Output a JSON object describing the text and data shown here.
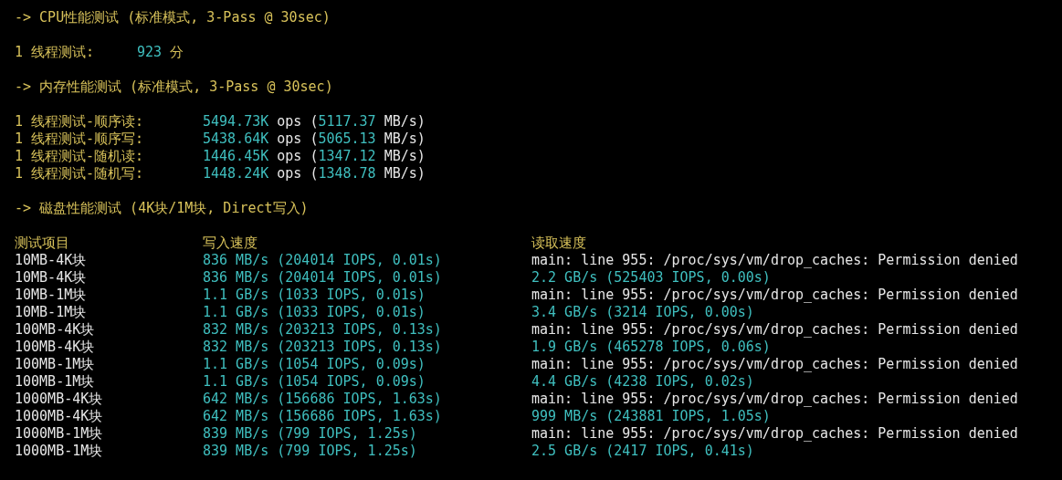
{
  "terminal": {
    "lines": [
      {
        "kind": "text",
        "cells": [
          [
            {
              "text": "-> CPU性能测试 (标准模式, 3-Pass @ 30sec)",
              "color": "#d8c25a"
            }
          ]
        ]
      },
      {
        "kind": "blank"
      },
      {
        "kind": "score",
        "cells": [
          [
            {
              "text": "1 线程测试:",
              "color": "#d8c25a"
            }
          ],
          [
            {
              "text": "923",
              "color": "#3fbfbf"
            },
            {
              "text": " 分",
              "color": "#d8c25a"
            }
          ]
        ]
      },
      {
        "kind": "blank"
      },
      {
        "kind": "text",
        "cells": [
          [
            {
              "text": "-> 内存性能测试 (标准模式, 3-Pass @ 30sec)",
              "color": "#d8c25a"
            }
          ]
        ]
      },
      {
        "kind": "blank"
      },
      {
        "kind": "metric",
        "cells": [
          [
            {
              "text": "1 线程测试-顺序读:",
              "color": "#d8c25a"
            }
          ],
          [
            {
              "text": "5494.73K",
              "color": "#3fbfbf"
            },
            {
              "text": " ops (",
              "color": "#e6e6e6"
            },
            {
              "text": "5117.37",
              "color": "#3fbfbf"
            },
            {
              "text": " MB/s)",
              "color": "#e6e6e6"
            }
          ]
        ]
      },
      {
        "kind": "metric",
        "cells": [
          [
            {
              "text": "1 线程测试-顺序写:",
              "color": "#d8c25a"
            }
          ],
          [
            {
              "text": "5438.64K",
              "color": "#3fbfbf"
            },
            {
              "text": " ops (",
              "color": "#e6e6e6"
            },
            {
              "text": "5065.13",
              "color": "#3fbfbf"
            },
            {
              "text": " MB/s)",
              "color": "#e6e6e6"
            }
          ]
        ]
      },
      {
        "kind": "metric",
        "cells": [
          [
            {
              "text": "1 线程测试-随机读:",
              "color": "#d8c25a"
            }
          ],
          [
            {
              "text": "1446.45K",
              "color": "#3fbfbf"
            },
            {
              "text": " ops (",
              "color": "#e6e6e6"
            },
            {
              "text": "1347.12",
              "color": "#3fbfbf"
            },
            {
              "text": " MB/s)",
              "color": "#e6e6e6"
            }
          ]
        ]
      },
      {
        "kind": "metric",
        "cells": [
          [
            {
              "text": "1 线程测试-随机写:",
              "color": "#d8c25a"
            }
          ],
          [
            {
              "text": "1448.24K",
              "color": "#3fbfbf"
            },
            {
              "text": " ops (",
              "color": "#e6e6e6"
            },
            {
              "text": "1348.78",
              "color": "#3fbfbf"
            },
            {
              "text": " MB/s)",
              "color": "#e6e6e6"
            }
          ]
        ]
      },
      {
        "kind": "blank"
      },
      {
        "kind": "text",
        "cells": [
          [
            {
              "text": "-> 磁盘性能测试 (4K块/1M块, Direct写入)",
              "color": "#d8c25a"
            }
          ]
        ]
      },
      {
        "kind": "blank"
      },
      {
        "kind": "table",
        "cells": [
          [
            {
              "text": "测试项目",
              "color": "#d8c25a"
            }
          ],
          [
            {
              "text": "写入速度",
              "color": "#d8c25a"
            }
          ],
          [
            {
              "text": "读取速度",
              "color": "#d8c25a"
            }
          ]
        ]
      },
      {
        "kind": "table",
        "cells": [
          [
            {
              "text": "10MB-4K块",
              "color": "#e6e6e6"
            }
          ],
          [
            {
              "text": "836 MB/s (204014 IOPS, 0.01s)",
              "color": "#3fbfbf"
            }
          ],
          [
            {
              "text": "main: line 955: /proc/sys/vm/drop_caches: Permission denied",
              "color": "#e6e6e6"
            }
          ]
        ]
      },
      {
        "kind": "table",
        "cells": [
          [
            {
              "text": "10MB-4K块",
              "color": "#e6e6e6"
            }
          ],
          [
            {
              "text": "836 MB/s (204014 IOPS, 0.01s)",
              "color": "#3fbfbf"
            }
          ],
          [
            {
              "text": "2.2 GB/s (525403 IOPS, 0.00s)",
              "color": "#3fbfbf"
            }
          ]
        ]
      },
      {
        "kind": "table",
        "cells": [
          [
            {
              "text": "10MB-1M块",
              "color": "#e6e6e6"
            }
          ],
          [
            {
              "text": "1.1 GB/s (1033 IOPS, 0.01s)",
              "color": "#3fbfbf"
            }
          ],
          [
            {
              "text": "main: line 955: /proc/sys/vm/drop_caches: Permission denied",
              "color": "#e6e6e6"
            }
          ]
        ]
      },
      {
        "kind": "table",
        "cells": [
          [
            {
              "text": "10MB-1M块",
              "color": "#e6e6e6"
            }
          ],
          [
            {
              "text": "1.1 GB/s (1033 IOPS, 0.01s)",
              "color": "#3fbfbf"
            }
          ],
          [
            {
              "text": "3.4 GB/s (3214 IOPS, 0.00s)",
              "color": "#3fbfbf"
            }
          ]
        ]
      },
      {
        "kind": "table",
        "cells": [
          [
            {
              "text": "100MB-4K块",
              "color": "#e6e6e6"
            }
          ],
          [
            {
              "text": "832 MB/s (203213 IOPS, 0.13s)",
              "color": "#3fbfbf"
            }
          ],
          [
            {
              "text": "main: line 955: /proc/sys/vm/drop_caches: Permission denied",
              "color": "#e6e6e6"
            }
          ]
        ]
      },
      {
        "kind": "table",
        "cells": [
          [
            {
              "text": "100MB-4K块",
              "color": "#e6e6e6"
            }
          ],
          [
            {
              "text": "832 MB/s (203213 IOPS, 0.13s)",
              "color": "#3fbfbf"
            }
          ],
          [
            {
              "text": "1.9 GB/s (465278 IOPS, 0.06s)",
              "color": "#3fbfbf"
            }
          ]
        ]
      },
      {
        "kind": "table",
        "cells": [
          [
            {
              "text": "100MB-1M块",
              "color": "#e6e6e6"
            }
          ],
          [
            {
              "text": "1.1 GB/s (1054 IOPS, 0.09s)",
              "color": "#3fbfbf"
            }
          ],
          [
            {
              "text": "main: line 955: /proc/sys/vm/drop_caches: Permission denied",
              "color": "#e6e6e6"
            }
          ]
        ]
      },
      {
        "kind": "table",
        "cells": [
          [
            {
              "text": "100MB-1M块",
              "color": "#e6e6e6"
            }
          ],
          [
            {
              "text": "1.1 GB/s (1054 IOPS, 0.09s)",
              "color": "#3fbfbf"
            }
          ],
          [
            {
              "text": "4.4 GB/s (4238 IOPS, 0.02s)",
              "color": "#3fbfbf"
            }
          ]
        ]
      },
      {
        "kind": "table",
        "cells": [
          [
            {
              "text": "1000MB-4K块",
              "color": "#e6e6e6"
            }
          ],
          [
            {
              "text": "642 MB/s (156686 IOPS, 1.63s)",
              "color": "#3fbfbf"
            }
          ],
          [
            {
              "text": "main: line 955: /proc/sys/vm/drop_caches: Permission denied",
              "color": "#e6e6e6"
            }
          ]
        ]
      },
      {
        "kind": "table",
        "cells": [
          [
            {
              "text": "1000MB-4K块",
              "color": "#e6e6e6"
            }
          ],
          [
            {
              "text": "642 MB/s (156686 IOPS, 1.63s)",
              "color": "#3fbfbf"
            }
          ],
          [
            {
              "text": "999 MB/s (243881 IOPS, 1.05s)",
              "color": "#3fbfbf"
            }
          ]
        ]
      },
      {
        "kind": "table",
        "cells": [
          [
            {
              "text": "1000MB-1M块",
              "color": "#e6e6e6"
            }
          ],
          [
            {
              "text": "839 MB/s (799 IOPS, 1.25s)",
              "color": "#3fbfbf"
            }
          ],
          [
            {
              "text": "main: line 955: /proc/sys/vm/drop_caches: Permission denied",
              "color": "#e6e6e6"
            }
          ]
        ]
      },
      {
        "kind": "table",
        "cells": [
          [
            {
              "text": "1000MB-1M块",
              "color": "#e6e6e6"
            }
          ],
          [
            {
              "text": "839 MB/s (799 IOPS, 1.25s)",
              "color": "#3fbfbf"
            }
          ],
          [
            {
              "text": "2.5 GB/s (2417 IOPS, 0.41s)",
              "color": "#3fbfbf"
            }
          ]
        ]
      }
    ]
  }
}
